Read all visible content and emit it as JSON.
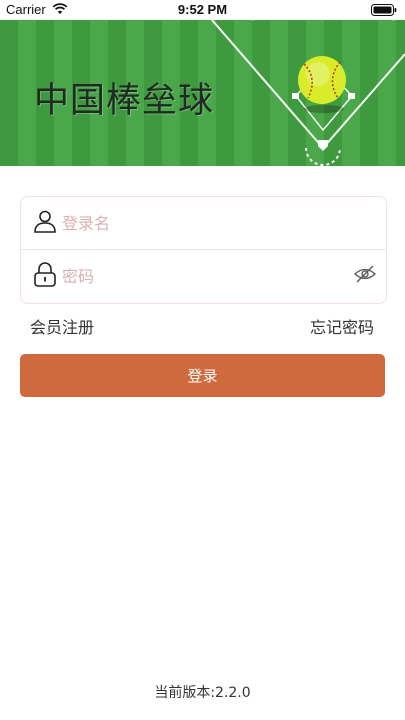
{
  "status_bar": {
    "carrier": "Carrier",
    "time": "9:52 PM"
  },
  "banner": {
    "title": "中国棒垒球"
  },
  "form": {
    "username_placeholder": "登录名",
    "password_placeholder": "密码"
  },
  "links": {
    "register": "会员注册",
    "forgot_password": "忘记密码"
  },
  "login_button": "登录",
  "footer": {
    "version": "当前版本:2.2.0"
  },
  "colors": {
    "accent": "#cf6a3e",
    "field_green": "#43a043",
    "border": "#f1e1e4"
  },
  "icons": [
    "wifi-icon",
    "battery-icon",
    "user-icon",
    "lock-icon",
    "eye-off-icon",
    "softball-icon"
  ]
}
